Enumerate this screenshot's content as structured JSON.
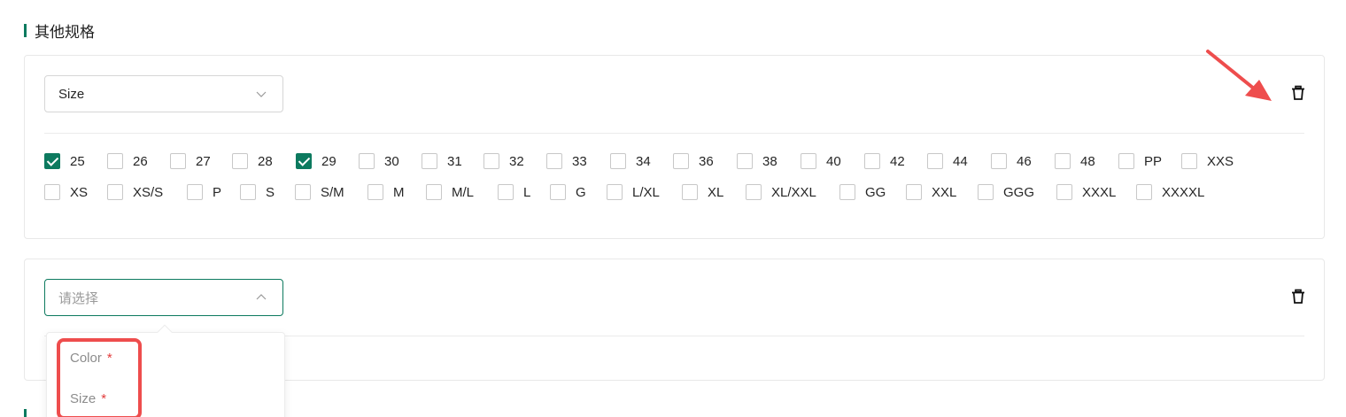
{
  "section": {
    "title": "其他规格"
  },
  "spec1": {
    "selected": "Size",
    "options": [
      {
        "label": "25",
        "checked": true
      },
      {
        "label": "26",
        "checked": false
      },
      {
        "label": "27",
        "checked": false
      },
      {
        "label": "28",
        "checked": false
      },
      {
        "label": "29",
        "checked": true
      },
      {
        "label": "30",
        "checked": false
      },
      {
        "label": "31",
        "checked": false
      },
      {
        "label": "32",
        "checked": false
      },
      {
        "label": "33",
        "checked": false
      },
      {
        "label": "34",
        "checked": false
      },
      {
        "label": "36",
        "checked": false
      },
      {
        "label": "38",
        "checked": false
      },
      {
        "label": "40",
        "checked": false
      },
      {
        "label": "42",
        "checked": false
      },
      {
        "label": "44",
        "checked": false
      },
      {
        "label": "46",
        "checked": false
      },
      {
        "label": "48",
        "checked": false
      },
      {
        "label": "PP",
        "checked": false
      },
      {
        "label": "XXS",
        "checked": false
      },
      {
        "label": "XS",
        "checked": false
      },
      {
        "label": "XS/S",
        "checked": false
      },
      {
        "label": "P",
        "checked": false
      },
      {
        "label": "S",
        "checked": false
      },
      {
        "label": "S/M",
        "checked": false
      },
      {
        "label": "M",
        "checked": false
      },
      {
        "label": "M/L",
        "checked": false
      },
      {
        "label": "L",
        "checked": false
      },
      {
        "label": "G",
        "checked": false
      },
      {
        "label": "L/XL",
        "checked": false
      },
      {
        "label": "XL",
        "checked": false
      },
      {
        "label": "XL/XXL",
        "checked": false
      },
      {
        "label": "GG",
        "checked": false
      },
      {
        "label": "XXL",
        "checked": false
      },
      {
        "label": "GGG",
        "checked": false
      },
      {
        "label": "XXXL",
        "checked": false
      },
      {
        "label": "XXXXL",
        "checked": false
      }
    ]
  },
  "spec2": {
    "placeholder": "请选择",
    "dropdown": [
      {
        "label": "Color",
        "required_mark": "*"
      },
      {
        "label": "Size",
        "required_mark": "*"
      }
    ]
  },
  "colors": {
    "accent": "#0d7a5f",
    "annotation": "#ee4d4d"
  },
  "icons": [
    "chevron-down-icon",
    "chevron-up-icon",
    "trash-icon",
    "arrow-annotation"
  ]
}
